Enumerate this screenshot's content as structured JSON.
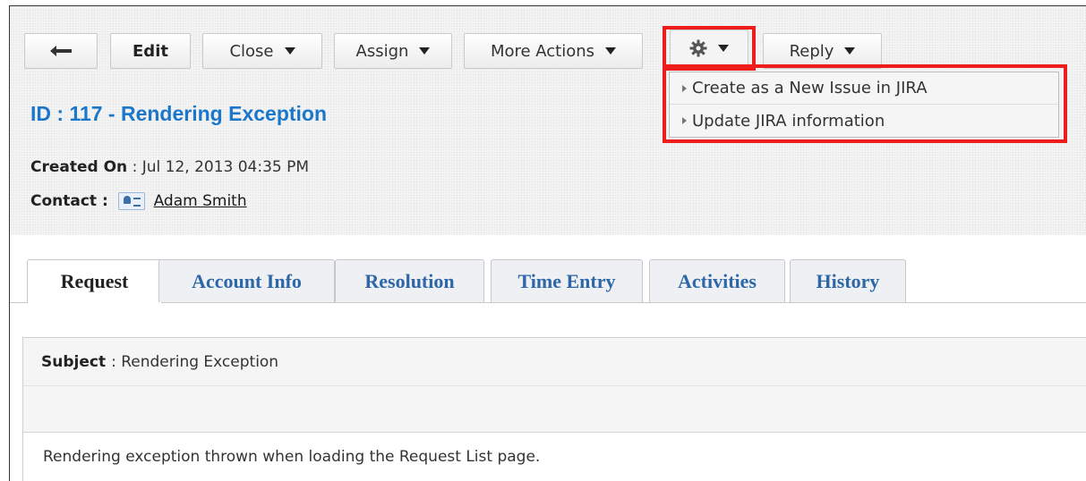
{
  "toolbar": {
    "back_icon": "arrow-left-icon",
    "edit_label": "Edit",
    "close_label": "Close",
    "assign_label": "Assign",
    "more_actions_label": "More Actions",
    "gear_icon": "gear-icon",
    "reply_label": "Reply"
  },
  "gear_menu": {
    "items": [
      {
        "label": "Create as a New Issue in JIRA"
      },
      {
        "label": "Update JIRA information"
      }
    ]
  },
  "highlight_color": "#ef1c1c",
  "request": {
    "title": "ID : 117 - Rendering Exception",
    "created_on_label": "Created On",
    "created_on_value": ": Jul 12, 2013 04:35 PM",
    "contact_label": "Contact :",
    "contact_name": "Adam Smith"
  },
  "tabs": [
    {
      "label": "Request",
      "active": true
    },
    {
      "label": "Account Info"
    },
    {
      "label": "Resolution"
    },
    {
      "label": "Time Entry"
    },
    {
      "label": "Activities"
    },
    {
      "label": "History"
    }
  ],
  "details": {
    "subject_label": "Subject",
    "subject_value": ": Rendering Exception",
    "description": "Rendering exception thrown when loading the Request List page."
  },
  "colors": {
    "title_blue": "#1b77c9",
    "tab_blue": "#2d67a8"
  }
}
